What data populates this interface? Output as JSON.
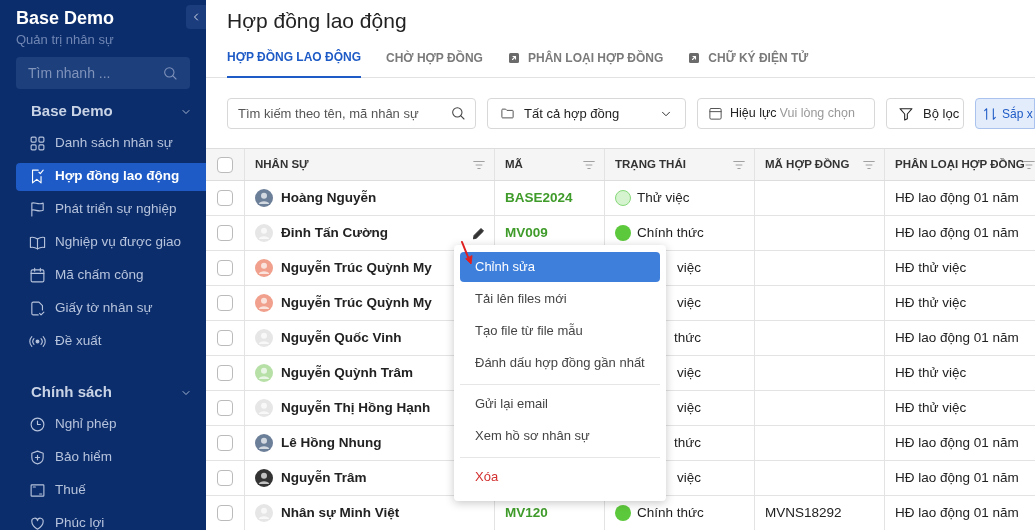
{
  "sidebar": {
    "title": "Base Demo",
    "subtitle": "Quản trị nhân sự",
    "search": {
      "placeholder": "Tìm nhanh ..."
    },
    "sections": [
      {
        "title": "Base Demo",
        "expanded": true,
        "items": [
          {
            "label": "Danh sách nhân sự",
            "selected": false
          },
          {
            "label": "Hợp đồng lao động",
            "selected": true
          },
          {
            "label": "Phát triển sự nghiệp",
            "selected": false
          },
          {
            "label": "Nghiệp vụ được giao",
            "selected": false
          },
          {
            "label": "Mã chấm công",
            "selected": false
          },
          {
            "label": "Giấy tờ nhân sự",
            "selected": false
          },
          {
            "label": "Đề xuất",
            "selected": false
          }
        ]
      },
      {
        "title": "Chính sách",
        "expanded": true,
        "items": [
          {
            "label": "Nghỉ phép",
            "selected": false
          },
          {
            "label": "Bảo hiểm",
            "selected": false
          },
          {
            "label": "Thuế",
            "selected": false
          },
          {
            "label": "Phúc lợi",
            "selected": false
          }
        ]
      }
    ]
  },
  "page": {
    "title": "Hợp đồng lao động",
    "tabs": [
      {
        "label": "HỢP ĐỒNG LAO ĐỘNG",
        "selected": true,
        "external": false
      },
      {
        "label": "CHỜ HỢP ĐỒNG",
        "selected": false,
        "external": false
      },
      {
        "label": "PHÂN LOẠI HỢP ĐỒNG",
        "selected": false,
        "external": true
      },
      {
        "label": "CHỮ KÝ ĐIỆN TỬ",
        "selected": false,
        "external": true
      }
    ],
    "search": {
      "placeholder": "Tìm kiếm theo tên, mã nhân sự"
    },
    "contract_filter": "Tất cả hợp đồng",
    "validity": {
      "label": "Hiệu lực",
      "placeholder": "Vui lòng chọn"
    },
    "filter_button": "Bộ lọc",
    "sort_button": "Sắp x"
  },
  "table": {
    "select_all_checked": false,
    "columns": [
      "NHÂN SỰ",
      "MÃ",
      "TRẠNG THÁI",
      "MÃ HỢP ĐỒNG",
      "PHÂN LOẠI HỢP ĐỒNG"
    ],
    "rows": [
      {
        "name": "Hoàng Nguyễn",
        "avatar": {
          "color": "#6c7f99"
        },
        "code": "BASE2024",
        "status": {
          "label": "Thử việc",
          "color": "#d6f3d0"
        },
        "contract_code": "",
        "type": "HĐ lao động 01 năm",
        "checked": false,
        "edit_icon": false
      },
      {
        "name": "Đinh Tấn Cường",
        "avatar": {
          "color": "#e6e6e6"
        },
        "code": "MV009",
        "status": {
          "label": "Chính thức",
          "color": "#5cc83b"
        },
        "contract_code": "",
        "type": "HĐ lao động 01 năm",
        "checked": false,
        "edit_icon": true
      },
      {
        "name": "Nguyễn Trúc Quỳnh My",
        "avatar": {
          "color": "#f0a08c"
        },
        "code": "",
        "status": {
          "label": "việc"
        },
        "contract_code": "",
        "type": "HĐ thử việc",
        "checked": false,
        "edit_icon": false
      },
      {
        "name": "Nguyễn Trúc Quỳnh My",
        "avatar": {
          "color": "#f0a08c"
        },
        "code": "",
        "status": {
          "label": "việc"
        },
        "contract_code": "",
        "type": "HĐ thử việc",
        "checked": false,
        "edit_icon": false
      },
      {
        "name": "Nguyễn Quốc Vinh",
        "avatar": {
          "color": "#e6e6e6"
        },
        "code": "",
        "status": {
          "label": "thức"
        },
        "contract_code": "",
        "type": "HĐ lao động 01 năm",
        "checked": false,
        "edit_icon": false
      },
      {
        "name": "Nguyễn Quỳnh Trâm",
        "avatar": {
          "color": "#b7e0a7"
        },
        "code": "",
        "status": {
          "label": "việc"
        },
        "contract_code": "",
        "type": "HĐ thử việc",
        "checked": false,
        "edit_icon": false
      },
      {
        "name": "Nguyễn Thị Hồng Hạnh",
        "avatar": {
          "color": "#e6e6e6"
        },
        "code": "",
        "status": {
          "label": "việc"
        },
        "contract_code": "",
        "type": "HĐ thử việc",
        "checked": false,
        "edit_icon": false
      },
      {
        "name": "Lê Hồng Nhung",
        "avatar": {
          "color": "#6c7f99"
        },
        "code": "",
        "status": {
          "label": "thức"
        },
        "contract_code": "",
        "type": "HĐ lao động 01 năm",
        "checked": false,
        "edit_icon": false
      },
      {
        "name": "Nguyễn Trâm",
        "avatar": {
          "color": "#333333"
        },
        "code": "",
        "status": {
          "label": "việc"
        },
        "contract_code": "",
        "type": "HĐ lao động 01 năm",
        "checked": false,
        "edit_icon": false
      },
      {
        "name": "Nhân sự Minh Việt",
        "avatar": {
          "color": "#e6e6e6"
        },
        "code": "MV120",
        "status": {
          "label": "Chính thức",
          "color": "#5cc83b"
        },
        "contract_code": "MVNS18292",
        "type": "HĐ lao động 01 năm",
        "checked": false,
        "edit_icon": false
      }
    ]
  },
  "context_menu": {
    "items": [
      {
        "label": "Chỉnh sửa",
        "kind": "item",
        "selected": true
      },
      {
        "label": "Tải lên files mới",
        "kind": "item",
        "selected": false
      },
      {
        "label": "Tạo file từ file mẫu",
        "kind": "item",
        "selected": false
      },
      {
        "label": "Đánh dấu hợp đồng gần nhất",
        "kind": "item",
        "selected": false
      },
      {
        "kind": "divider"
      },
      {
        "label": "Gửi lại email",
        "kind": "item",
        "selected": false
      },
      {
        "label": "Xem hồ sơ nhân sự",
        "kind": "item",
        "selected": false
      },
      {
        "kind": "divider"
      },
      {
        "label": "Xóa",
        "kind": "danger",
        "selected": false
      }
    ]
  }
}
